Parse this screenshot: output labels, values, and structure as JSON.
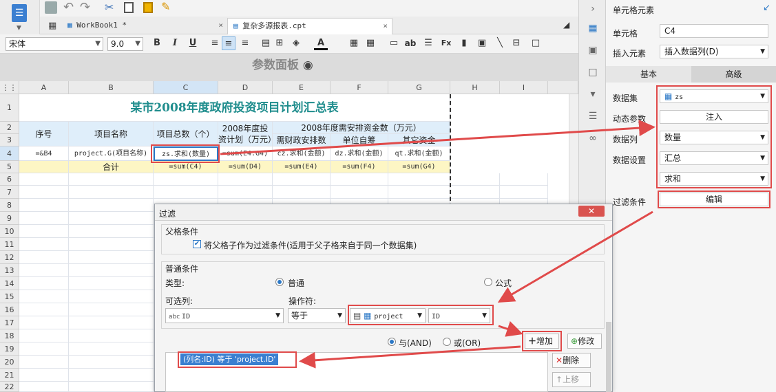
{
  "tabs": [
    {
      "label": "WorkBook1 *"
    },
    {
      "label": "复杂多源报表.cpt"
    }
  ],
  "format": {
    "font": "宋体",
    "size": "9.0"
  },
  "param_panel": "参数面板",
  "columns": [
    "A",
    "B",
    "C",
    "D",
    "E",
    "F",
    "G",
    "H",
    "I"
  ],
  "rows": [
    "1",
    "2",
    "3",
    "4",
    "5",
    "6",
    "7",
    "8",
    "9",
    "10",
    "11",
    "12",
    "13",
    "14",
    "15",
    "16",
    "17",
    "18",
    "19",
    "20",
    "21",
    "22"
  ],
  "report": {
    "title": "某市2008年度政府投资项目计划汇总表",
    "h_seq": "序号",
    "h_name": "项目名称",
    "h_total": "项目总数（个）",
    "h_plan": "2008年度投资计划（万元）",
    "h_need": "2008年度需安排资金数（万元）",
    "h_fin": "需财政安排数",
    "h_self": "单位自筹",
    "h_other": "其它资金",
    "r4": {
      "a": "=&B4",
      "b": "project.G(项目名称)",
      "c": "zs.求和(数量)",
      "d": "=sum(E4:G4)",
      "e": "cz.求和(金额)",
      "f": "dz.求和(金额)",
      "g": "qt.求和(金额)"
    },
    "r5": {
      "b": "合计",
      "c": "=sum(C4)",
      "d": "=sum(D4)",
      "e": "=sum(E4)",
      "f": "=sum(F4)",
      "g": "=sum(G4)"
    }
  },
  "panel": {
    "title": "单元格元素",
    "cell_label": "单元格",
    "cell_value": "C4",
    "insert_label": "插入元素",
    "insert_value": "插入数据列(D)",
    "tab_basic": "基本",
    "tab_adv": "高级",
    "dataset_label": "数据集",
    "dataset_value": "zs",
    "dynamic_label": "动态参数",
    "inject_btn": "注入",
    "column_label": "数据列",
    "column_value": "数量",
    "setting_label": "数据设置",
    "setting_value": "汇总",
    "agg_value": "求和",
    "filter_label": "过滤条件",
    "edit_btn": "编辑"
  },
  "dialog": {
    "title": "过滤",
    "parent_group": "父格条件",
    "parent_check": "将父格子作为过滤条件(适用于父子格来自于同一个数据集)",
    "normal_group": "普通条件",
    "type_label": "类型:",
    "type_normal": "普通",
    "type_formula": "公式",
    "col_label": "可选列:",
    "col_value": "ID",
    "op_label": "操作符:",
    "op_value": "等于",
    "ds_value": "project",
    "field_value": "ID",
    "and_label": "与(AND)",
    "or_label": "或(OR)",
    "add_btn": "增加",
    "modify_btn": "修改",
    "delete_btn": "删除",
    "up_btn": "上移",
    "condition": "(列名:ID) 等于 'project.ID'"
  },
  "colors": {
    "accent": "#1d8fbf",
    "red": "#e04a4a",
    "title_teal": "#1f8d8d"
  }
}
